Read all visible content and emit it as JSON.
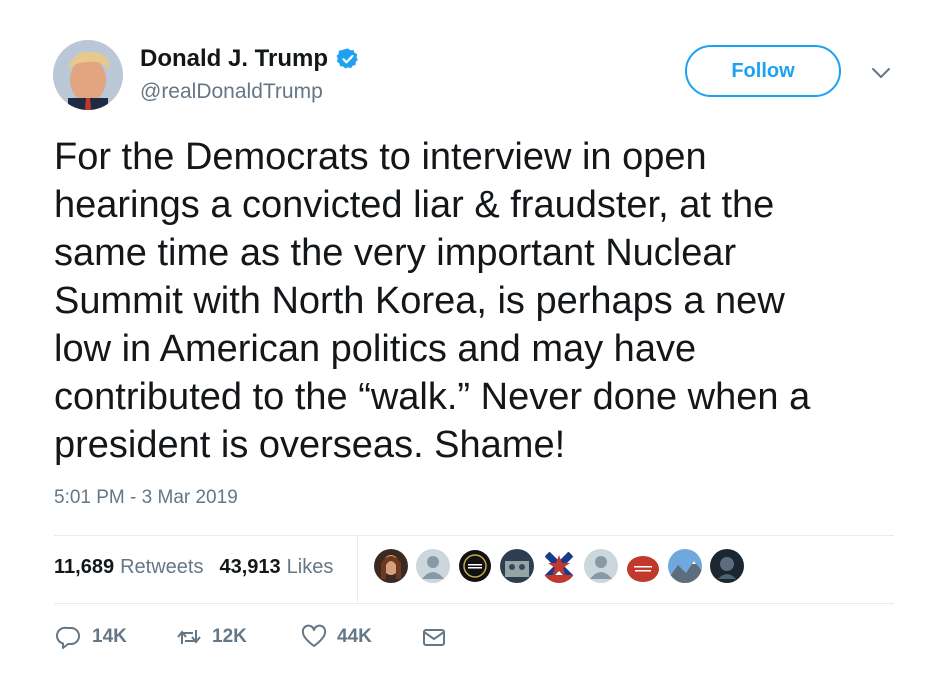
{
  "user": {
    "display_name": "Donald J. Trump",
    "handle": "@realDonaldTrump",
    "verified": true
  },
  "follow_label": "Follow",
  "tweet": {
    "text": "For the Democrats to interview in open\nhearings a convicted liar & fraudster, at the\nsame time as the very important Nuclear\nSummit with North Korea, is perhaps a new\nlow in American politics and may have\ncontributed to the “walk.” Never done when a\npresident is overseas. Shame!",
    "timestamp": "5:01 PM - 3 Mar 2019"
  },
  "stats": {
    "retweets_count": "11,689",
    "retweets_label": "Retweets",
    "likes_count": "43,913",
    "likes_label": "Likes"
  },
  "actions": {
    "reply_count": "14K",
    "retweet_count": "12K",
    "like_count": "44K"
  },
  "colors": {
    "accent": "#1da1f2",
    "muted": "#657786",
    "text": "#14171a",
    "divider": "#e6ecf0"
  },
  "icons": {
    "verified": "verified-badge-icon",
    "chevron": "chevron-down-icon",
    "reply": "reply-icon",
    "retweet": "retweet-icon",
    "like": "heart-icon",
    "dm": "envelope-icon"
  }
}
